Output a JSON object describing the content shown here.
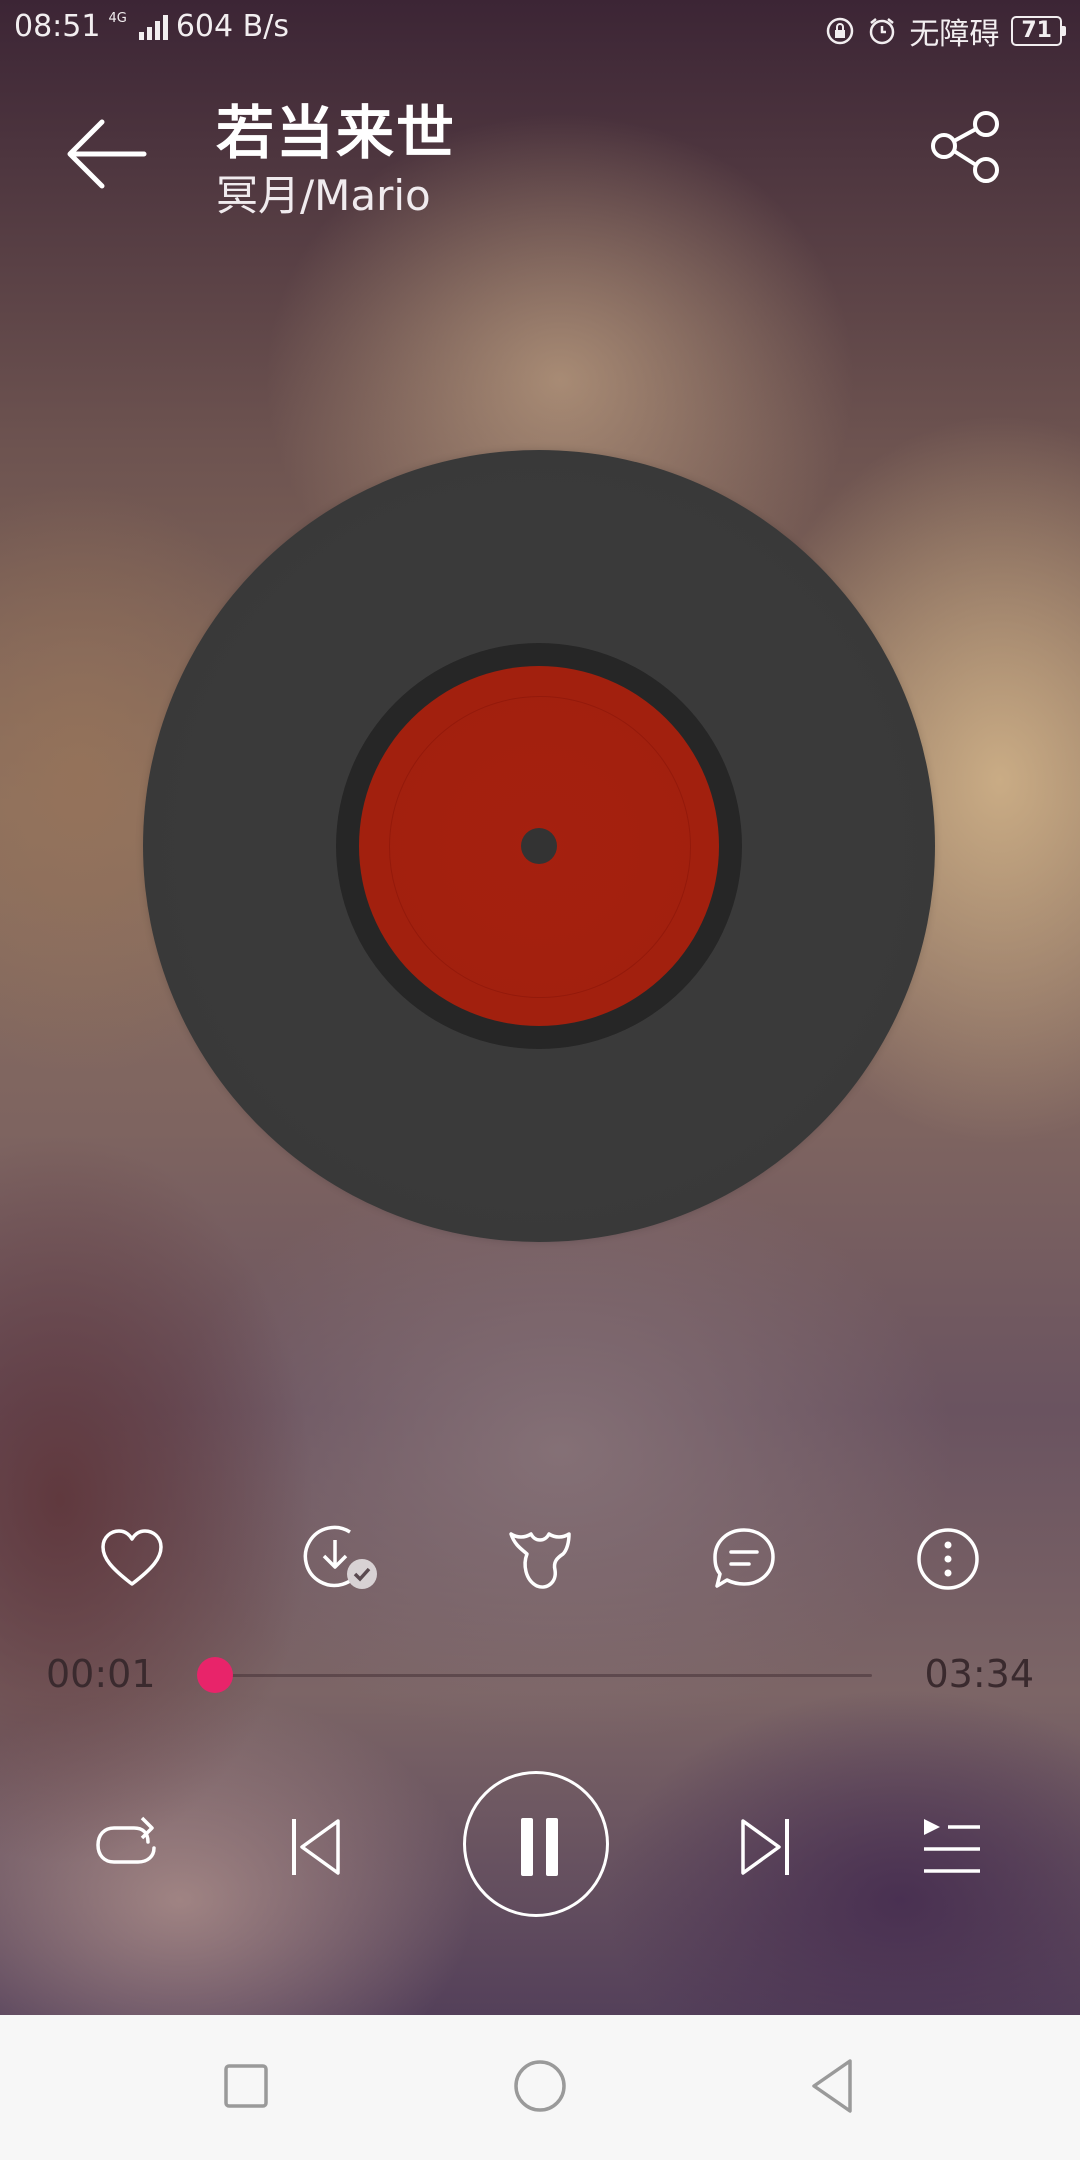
{
  "status_bar": {
    "time": "08:51",
    "network_type": "4G",
    "speed": "604 B/s",
    "accessibility": "无障碍",
    "battery": "71"
  },
  "header": {
    "song_title": "若当来世",
    "artist": "冥月/Mario"
  },
  "player": {
    "current_time": "00:01",
    "total_time": "03:34",
    "progress_fraction": 0.005,
    "accent_color": "#e8246a",
    "record_label_color": "#a5200f"
  },
  "actions": [
    "heart-icon",
    "download-done-icon",
    "effects-icon",
    "comment-icon",
    "more-icon"
  ],
  "transport": [
    "repeat-icon",
    "previous-icon",
    "pause-icon",
    "next-icon",
    "playlist-icon"
  ],
  "navbar": [
    "recent-apps-icon",
    "home-icon",
    "back-icon"
  ]
}
